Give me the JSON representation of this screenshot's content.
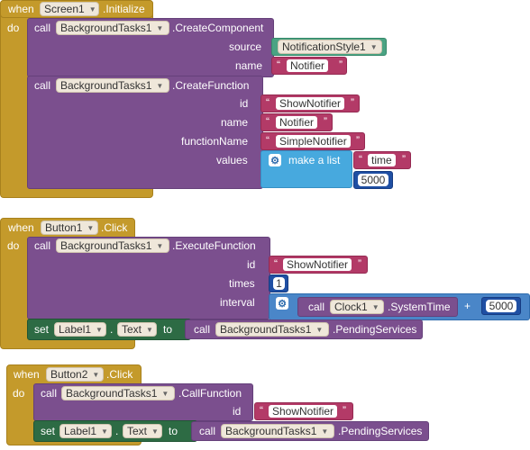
{
  "kw": {
    "when": "when",
    "do": "do",
    "call": "call",
    "set": "set",
    "to": "to",
    "plus": "+"
  },
  "b1": {
    "component": "Screen1",
    "event": ".Initialize",
    "s1": {
      "component": "BackgroundTasks1",
      "method": ".CreateComponent",
      "source_label": "source",
      "source_value": "NotificationStyle1",
      "name_label": "name",
      "name_value": "Notifier"
    },
    "s2": {
      "component": "BackgroundTasks1",
      "method": ".CreateFunction",
      "id_label": "id",
      "id_value": "ShowNotifier",
      "name_label": "name",
      "name_value": "Notifier",
      "fn_label": "functionName",
      "fn_value": "SimpleNotifier",
      "values_label": "values",
      "list_label": "make a list",
      "item1": "time",
      "item2": "5000"
    }
  },
  "b2": {
    "component": "Button1",
    "event": ".Click",
    "s1": {
      "component": "BackgroundTasks1",
      "method": ".ExecuteFunction",
      "id_label": "id",
      "id_value": "ShowNotifier",
      "times_label": "times",
      "times_value": "1",
      "interval_label": "interval",
      "clock": "Clock1",
      "clock_method": ".SystemTime",
      "add_value": "5000"
    },
    "s2": {
      "label": "Label1",
      "prop": "Text",
      "call_component": "BackgroundTasks1",
      "call_method": ".PendingServices"
    }
  },
  "b3": {
    "component": "Button2",
    "event": ".Click",
    "s1": {
      "component": "BackgroundTasks1",
      "method": ".CallFunction",
      "id_label": "id",
      "id_value": "ShowNotifier"
    },
    "s2": {
      "label": "Label1",
      "prop": "Text",
      "call_component": "BackgroundTasks1",
      "call_method": ".PendingServices"
    }
  }
}
